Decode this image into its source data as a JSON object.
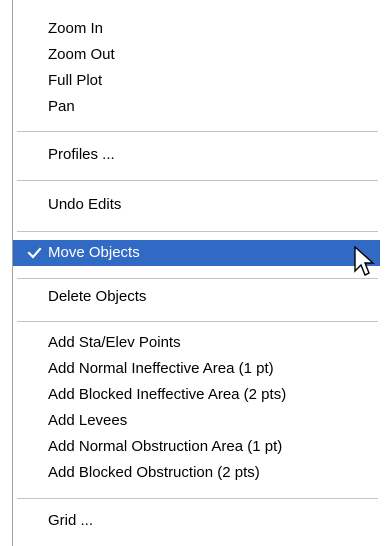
{
  "menu": {
    "items": [
      {
        "label": "Zoom In"
      },
      {
        "label": "Zoom Out"
      },
      {
        "label": "Full Plot"
      },
      {
        "label": "Pan"
      },
      {
        "label": "Profiles ..."
      },
      {
        "label": "Undo Edits"
      },
      {
        "label": "Move Objects",
        "checked": true,
        "highlighted": true
      },
      {
        "label": "Delete Objects"
      },
      {
        "label": "Add Sta/Elev Points"
      },
      {
        "label": "Add Normal Ineffective Area (1 pt)"
      },
      {
        "label": "Add Blocked Ineffective Area (2 pts)"
      },
      {
        "label": "Add Levees"
      },
      {
        "label": "Add Normal Obstruction Area (1 pt)"
      },
      {
        "label": "Add Blocked Obstruction (2 pts)"
      },
      {
        "label": "Grid ..."
      }
    ]
  },
  "colors": {
    "highlight": "#316ac5",
    "highlight_text": "#ffffff",
    "separator": "#c4c4c4"
  },
  "icons": {
    "check": "check-icon",
    "cursor": "mouse-pointer-icon"
  }
}
